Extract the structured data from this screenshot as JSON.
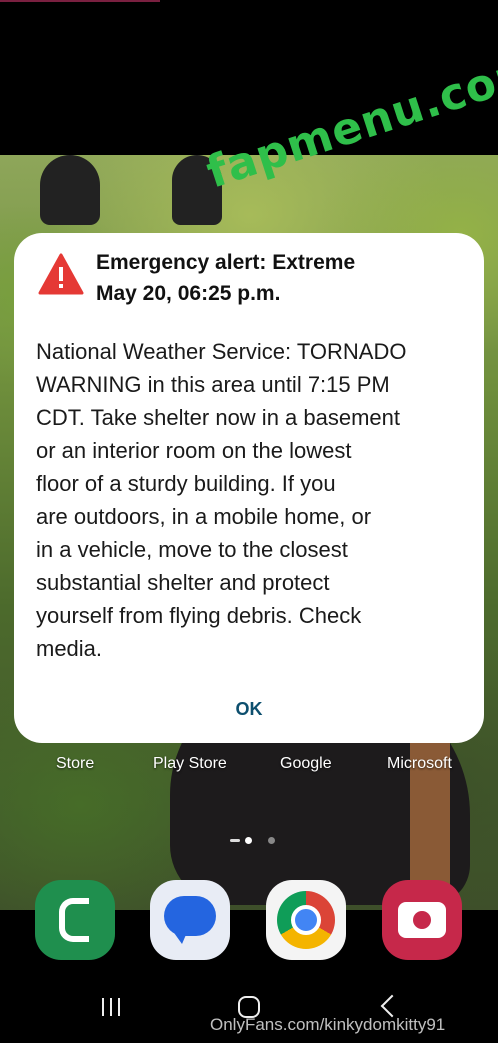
{
  "watermarks": {
    "top": "fapmenu.com",
    "bottom": "OnlyFans.com/kinkydomkitty91"
  },
  "home_screen": {
    "apps": [
      {
        "label": "Store"
      },
      {
        "label": "Play Store"
      },
      {
        "label": "Google"
      },
      {
        "label": "Microsoft"
      }
    ],
    "dock": [
      {
        "name": "Phone",
        "icon": "phone-icon",
        "color": "#1f8f4e"
      },
      {
        "name": "Messages",
        "icon": "messages-icon",
        "color": "#2465e0"
      },
      {
        "name": "Chrome",
        "icon": "chrome-icon",
        "color": "#db4437"
      },
      {
        "name": "Camera",
        "icon": "camera-icon",
        "color": "#c6284a"
      }
    ],
    "page_indicator": {
      "pages": 2,
      "current": 1
    }
  },
  "alert": {
    "icon": "warning-triangle-icon",
    "icon_color": "#e53935",
    "title_line1": "Emergency alert: Extreme",
    "title_line2": "May 20, 06:25 p.m.",
    "body_lines": [
      "National Weather Service: TORNADO",
      "WARNING in this area until 7:15 PM",
      "CDT. Take shelter now in a basement",
      "or an interior room on the lowest",
      "floor of a sturdy building. If you",
      "are outdoors, in a mobile home, or",
      "in a vehicle, move to the closest",
      "substantial shelter and protect",
      "yourself from flying debris. Check",
      "media."
    ],
    "ok_label": "OK",
    "ok_color": "#0d4f6e"
  },
  "navbar": {
    "recents_icon": "recents-icon",
    "home_icon": "home-icon",
    "back_icon": "back-icon"
  }
}
